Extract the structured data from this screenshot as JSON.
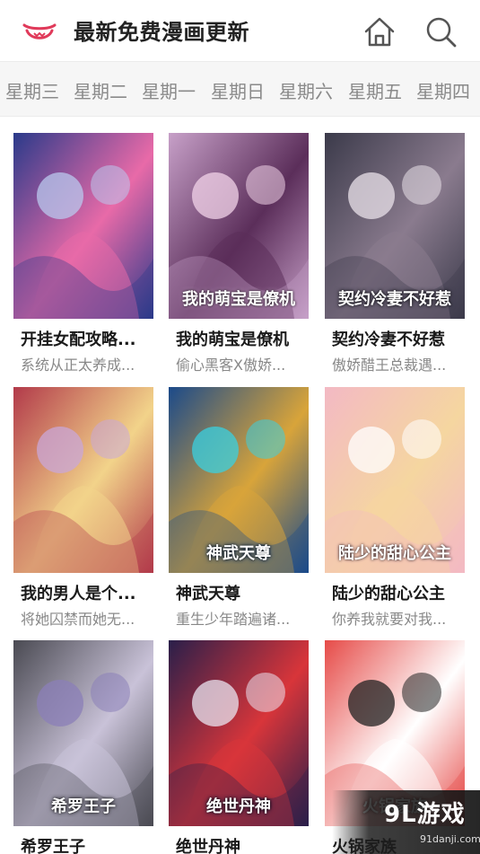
{
  "header": {
    "title": "最新免费漫画更新",
    "logo_icon": "mascot-logo-icon",
    "home_icon": "home-icon",
    "search_icon": "search-icon",
    "accent_color": "#e03a5a"
  },
  "tabs": [
    "星期三",
    "星期二",
    "星期一",
    "星期日",
    "星期六",
    "星期五",
    "星期四"
  ],
  "comics": [
    {
      "name": "开挂女配攻略...",
      "desc": "系统从正太养成...",
      "cover_text": "",
      "palette": [
        "#2a3a8a",
        "#e86aa8",
        "#b9c8ee"
      ]
    },
    {
      "name": "我的萌宝是僚机",
      "desc": "偷心黑客X傲娇...",
      "cover_text": "我的萌宝是僚机",
      "palette": [
        "#c7a0c8",
        "#5b2e5a",
        "#f1d3e8"
      ]
    },
    {
      "name": "契约冷妻不好惹",
      "desc": "傲娇醋王总裁遇...",
      "cover_text": "契约冷妻不好惹",
      "palette": [
        "#3b3a4a",
        "#8a7b8e",
        "#e9e2ea"
      ]
    },
    {
      "name": "我的男人是个...",
      "desc": "将她囚禁而她无...",
      "cover_text": "",
      "palette": [
        "#b23a4a",
        "#f2d38a",
        "#c9a7d8"
      ]
    },
    {
      "name": "神武天尊",
      "desc": "重生少年踏遍诸...",
      "cover_text": "神武天尊",
      "palette": [
        "#1b4a8a",
        "#d8a43a",
        "#3ad0e0"
      ]
    },
    {
      "name": "陆少的甜心公主",
      "desc": "你养我就要对我...",
      "cover_text": "陆少的甜心公主",
      "palette": [
        "#f3b9c4",
        "#f5d6a0",
        "#ffffff"
      ]
    },
    {
      "name": "希罗王子",
      "desc": "",
      "cover_text": "希罗王子",
      "palette": [
        "#4a4a52",
        "#c9c2d8",
        "#8b7fb8"
      ]
    },
    {
      "name": "绝世丹神",
      "desc": "",
      "cover_text": "绝世丹神",
      "palette": [
        "#2a1f4a",
        "#d8353a",
        "#e9e4f0"
      ]
    },
    {
      "name": "火锅家族",
      "desc": "",
      "cover_text": "火锅家族",
      "palette": [
        "#e64b48",
        "#ffffff",
        "#222222"
      ]
    }
  ],
  "watermark": {
    "logo": "9L游戏",
    "site": "91danji.com"
  }
}
